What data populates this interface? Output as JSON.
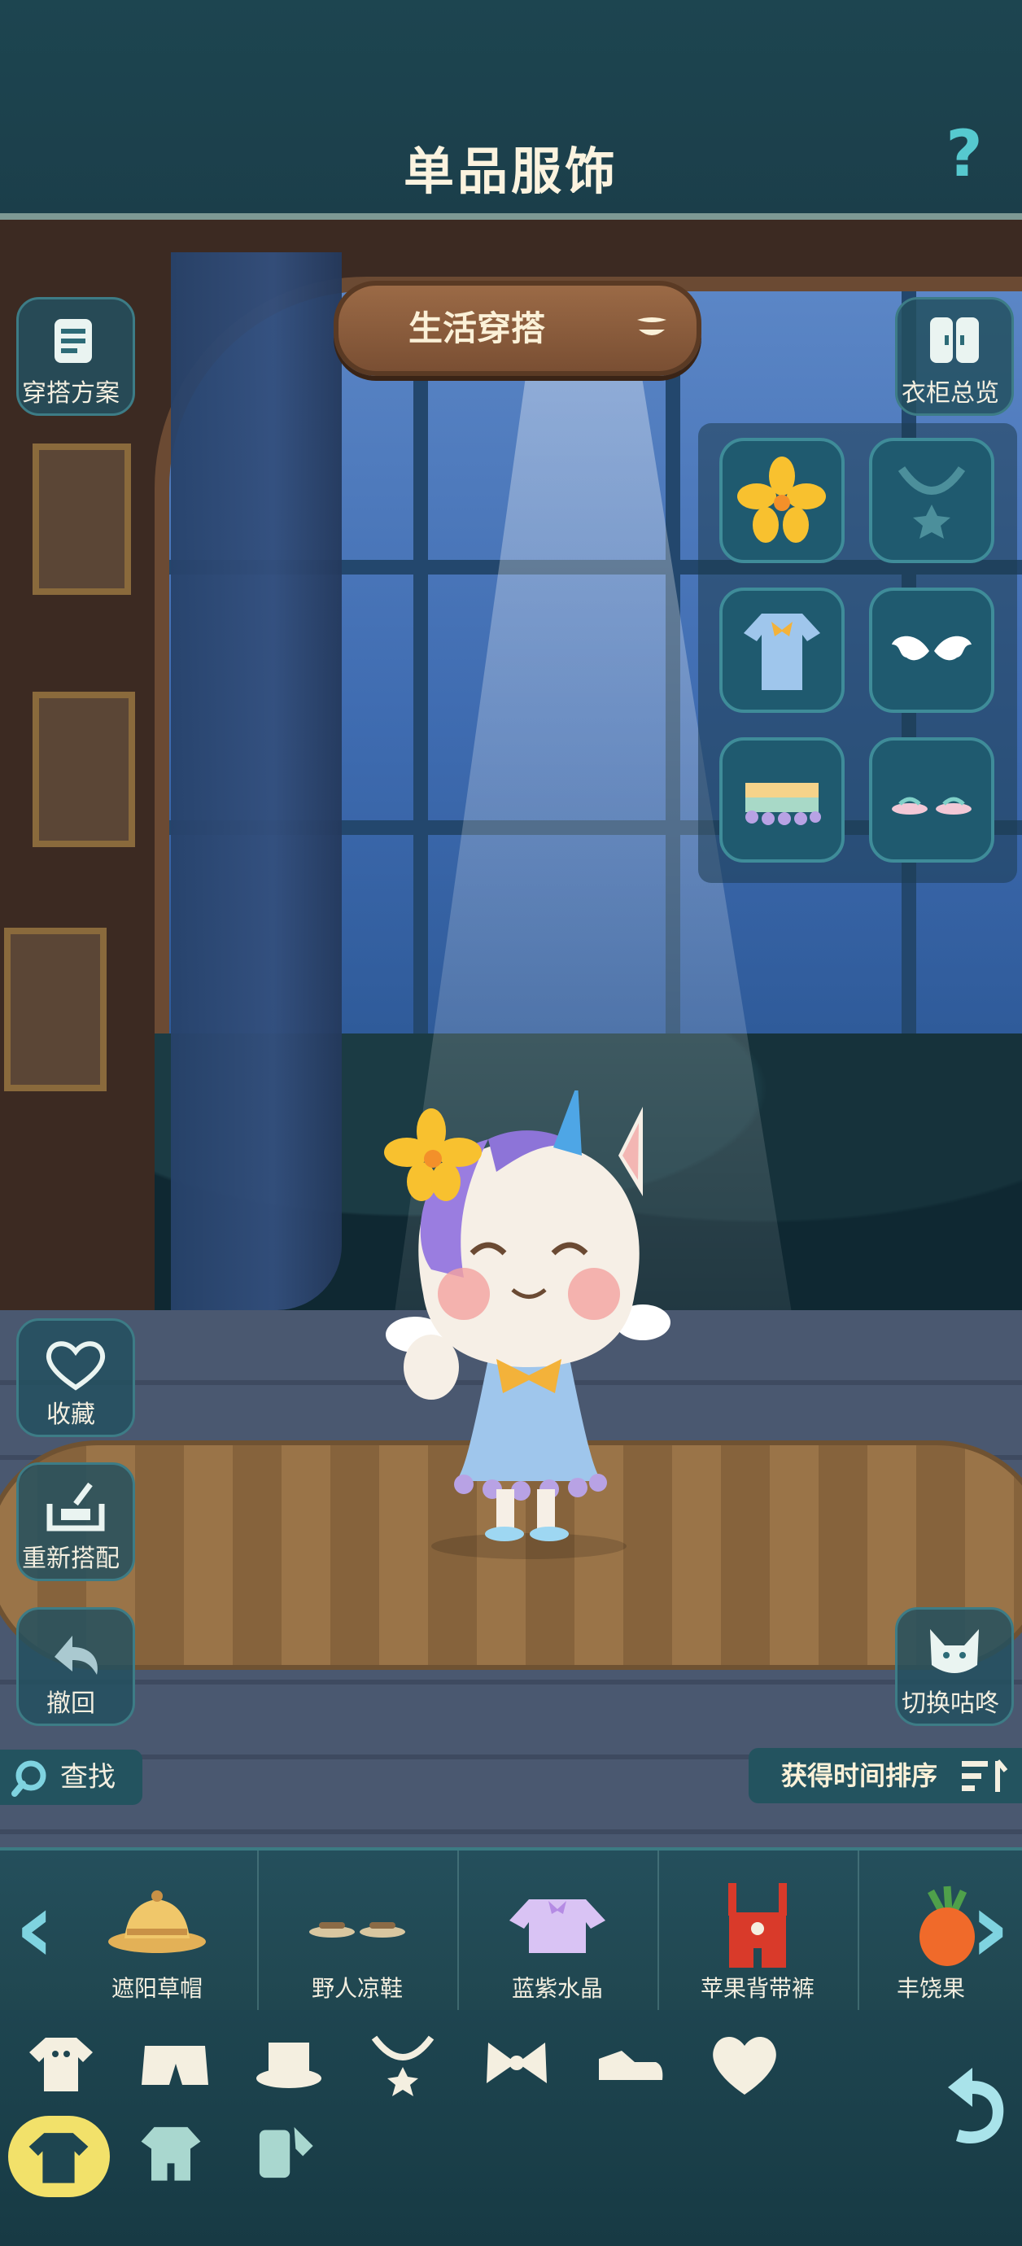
{
  "header": {
    "title": "单品服饰",
    "help_icon": "question-mark-icon"
  },
  "outfit_selector": {
    "label": "生活穿搭"
  },
  "left_buttons": [
    {
      "label": "穿搭方案",
      "icon": "outfit-plan-icon"
    },
    {
      "label": "收藏",
      "icon": "heart-icon"
    },
    {
      "label": "重新搭配",
      "icon": "re-match-icon"
    },
    {
      "label": "撤回",
      "icon": "undo-arrow-icon"
    }
  ],
  "right_buttons": [
    {
      "label": "衣柜总览",
      "icon": "wardrobe-icon"
    },
    {
      "label": "切换咕咚",
      "icon": "switch-character-icon"
    }
  ],
  "equipped_slots": [
    {
      "slot": "head",
      "icon": "yellow-flower-icon"
    },
    {
      "slot": "neck",
      "icon": "necklace-icon"
    },
    {
      "slot": "top",
      "icon": "blue-dress-icon"
    },
    {
      "slot": "back",
      "icon": "wings-icon"
    },
    {
      "slot": "bottom",
      "icon": "pastel-skirt-icon"
    },
    {
      "slot": "shoes",
      "icon": "sandals-icon"
    }
  ],
  "search": {
    "label": "查找"
  },
  "sort": {
    "label": "获得时间排序"
  },
  "items": [
    {
      "label": "遮阳草帽",
      "icon": "straw-hat-icon"
    },
    {
      "label": "野人凉鞋",
      "icon": "sandals-icon"
    },
    {
      "label": "蓝紫水晶",
      "icon": "purple-top-icon"
    },
    {
      "label": "苹果背带裤",
      "icon": "red-overalls-icon"
    },
    {
      "label": "丰饶果",
      "icon": "carrot-icon"
    }
  ],
  "categories": [
    "shirt-icon",
    "pants-icon",
    "hat-icon",
    "necklace-icon",
    "bow-icon",
    "shoe-icon",
    "heart-icon"
  ],
  "sub_categories": [
    "clothes-icon",
    "outfit-set-icon",
    "dye-icon"
  ],
  "colors": {
    "accent": "#56c9cf",
    "panel": "#23535f",
    "active_tab": "#f2e16a"
  }
}
